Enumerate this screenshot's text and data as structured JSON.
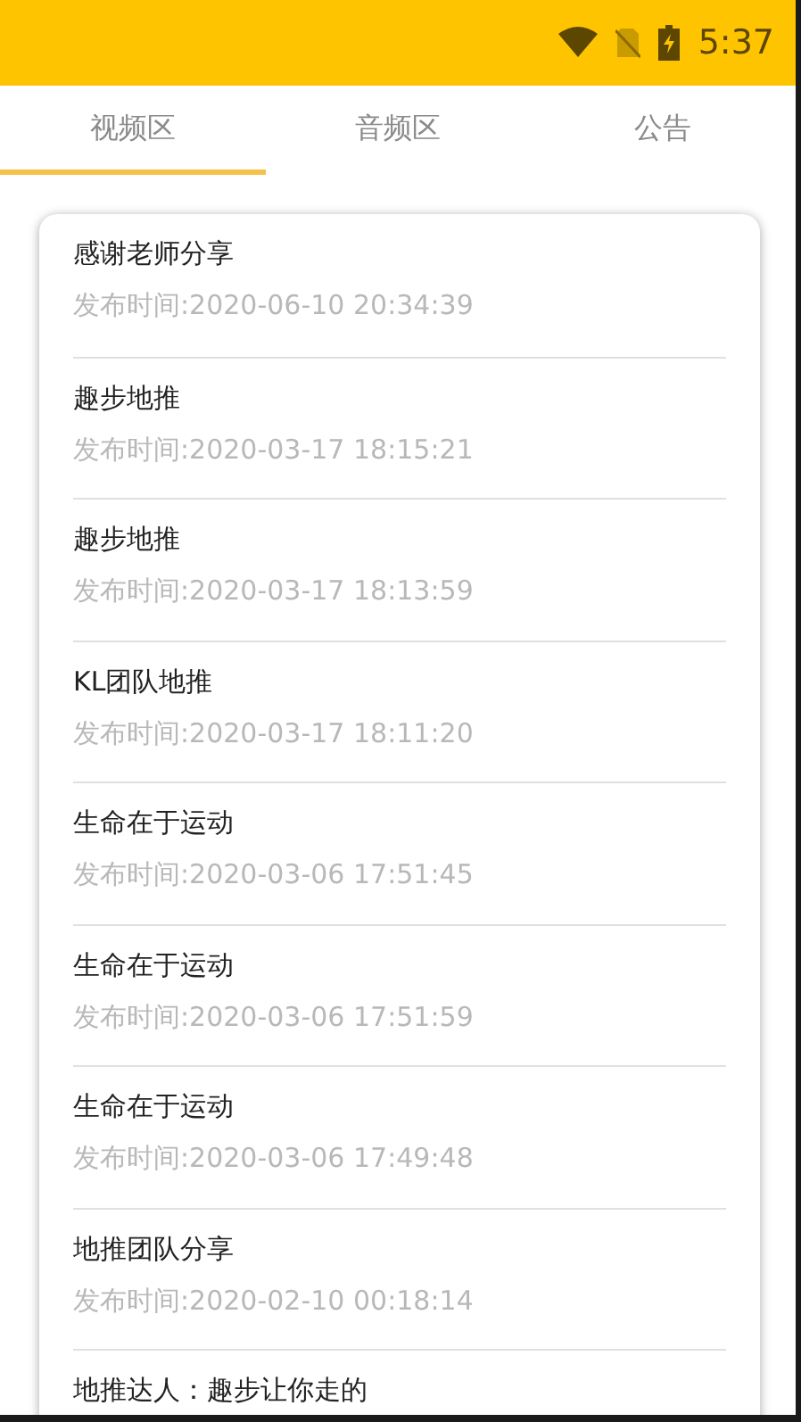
{
  "status_bar": {
    "time": "5:37"
  },
  "tabs": [
    {
      "label": "视频区",
      "selected": true
    },
    {
      "label": "音频区",
      "selected": false
    },
    {
      "label": "公告",
      "selected": false
    }
  ],
  "posts": [
    {
      "title": "感谢老师分享",
      "time": "发布时间:2020-06-10 20:34:39"
    },
    {
      "title": "趣步地推",
      "time": "发布时间:2020-03-17 18:15:21"
    },
    {
      "title": "趣步地推",
      "time": "发布时间:2020-03-17 18:13:59"
    },
    {
      "title": "KL团队地推",
      "time": "发布时间:2020-03-17 18:11:20"
    },
    {
      "title": "生命在于运动",
      "time": "发布时间:2020-03-06 17:51:45"
    },
    {
      "title": "生命在于运动",
      "time": "发布时间:2020-03-06 17:51:59"
    },
    {
      "title": "生命在于运动",
      "time": "发布时间:2020-03-06 17:49:48"
    },
    {
      "title": "地推团队分享",
      "time": "发布时间:2020-02-10 00:18:14"
    },
    {
      "title": "地推达人：趣步让你走的"
    }
  ]
}
